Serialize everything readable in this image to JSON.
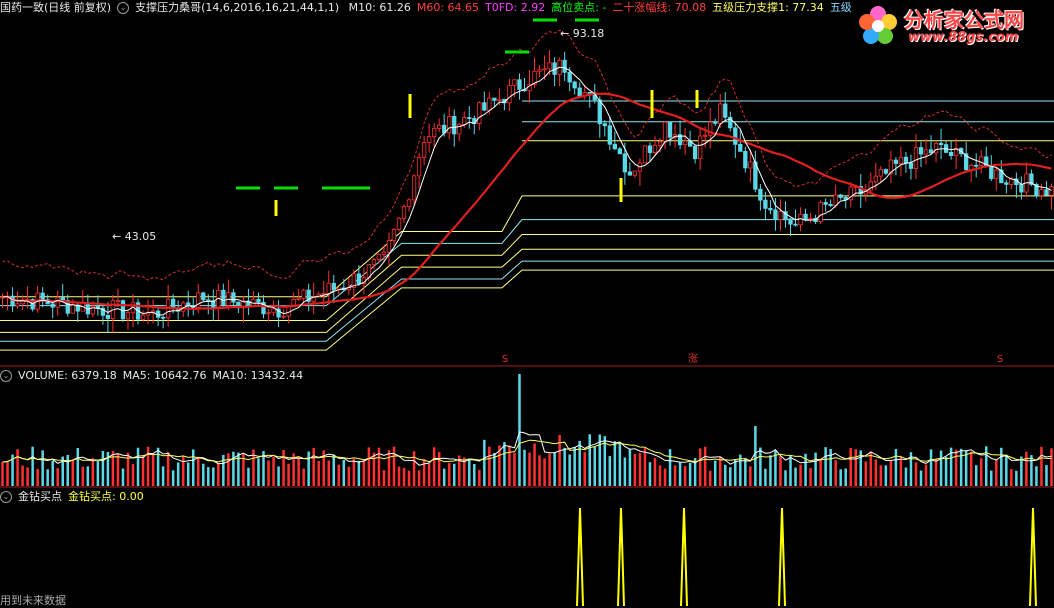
{
  "main_panel": {
    "stock_name": "国药一致(日线 前复权)",
    "indicator_name": "支撑压力桑哥(14,6,2016,16,21,44,1,1)",
    "values": [
      {
        "label": "M10: 61.26",
        "color": "#e8e8e8"
      },
      {
        "label": "M60: 64.65",
        "color": "#ff4040"
      },
      {
        "label": "T0FD: 2.92",
        "color": "#ff40ff"
      },
      {
        "label": "高位卖点: -",
        "color": "#00ff00"
      },
      {
        "label": "二十涨幅线: 70.08",
        "color": "#ff4040"
      },
      {
        "label": "五级压力支撑1: 77.34",
        "color": "#ffff60"
      },
      {
        "label": "五级",
        "color": "#7fd8ff"
      }
    ],
    "annotations": {
      "high": "93.18",
      "low": "43.05"
    },
    "markers": [
      {
        "label": "S",
        "x": 505
      },
      {
        "label": "涨",
        "x": 693
      },
      {
        "label": "S",
        "x": 1000
      }
    ]
  },
  "volume_panel": {
    "name": "VOLUME: 6379.18",
    "ma5": "MA5: 10642.76",
    "ma10": "MA10: 13432.44"
  },
  "signal_panel": {
    "name": "金钻买点",
    "value": "金钻买点: 0.00"
  },
  "footer_text": "用到未来数据",
  "logo": {
    "name": "分析家公式网",
    "url": "www.88gs.com"
  },
  "chart_data": {
    "type": "line",
    "series": [
      {
        "name": "M10"
      },
      {
        "name": "M60"
      }
    ],
    "range": [
      40,
      98
    ],
    "annotated_high": 93.18,
    "annotated_low": 43.05,
    "support_levels": [
      {
        "label": "五级压力支撑1",
        "value": 77.34
      }
    ],
    "signal_positions": [
      580,
      621,
      684,
      782,
      1033
    ]
  },
  "colors": {
    "up": "#ff3030",
    "down": "#5ad8e8",
    "ma60": "#e02020",
    "price_line": "#ffffff",
    "support": "#ffff80",
    "support_blue": "#8ee6f2",
    "signal": "#ffff00"
  }
}
